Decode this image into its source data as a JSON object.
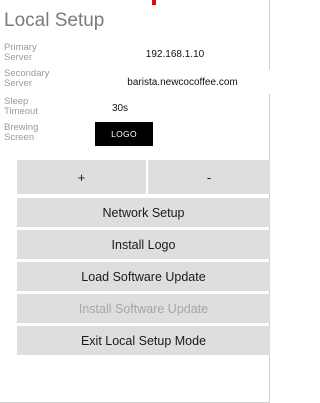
{
  "header": {
    "title": "Local Setup"
  },
  "settings": [
    {
      "label": "Primary\nServer",
      "value": "192.168.1.10"
    },
    {
      "label": "Secondary\nServer",
      "value": "barista.newcocoffee.com"
    },
    {
      "label": "Sleep\nTimeout",
      "value": "30s"
    },
    {
      "label": "Brewing\nScreen",
      "value": "LOGO"
    }
  ],
  "stepper": {
    "plus_label": "+",
    "minus_label": "-"
  },
  "actions": {
    "network_setup": "Network Setup",
    "install_logo": "Install Logo",
    "load_update": "Load Software Update",
    "install_update": "Install Software Update",
    "exit": "Exit Local Setup Mode"
  },
  "colors": {
    "button_bg": "#dedede",
    "disabled_text": "#a6a6a6",
    "title_text": "#7b7b7b",
    "label_text": "#9a9a9a"
  }
}
